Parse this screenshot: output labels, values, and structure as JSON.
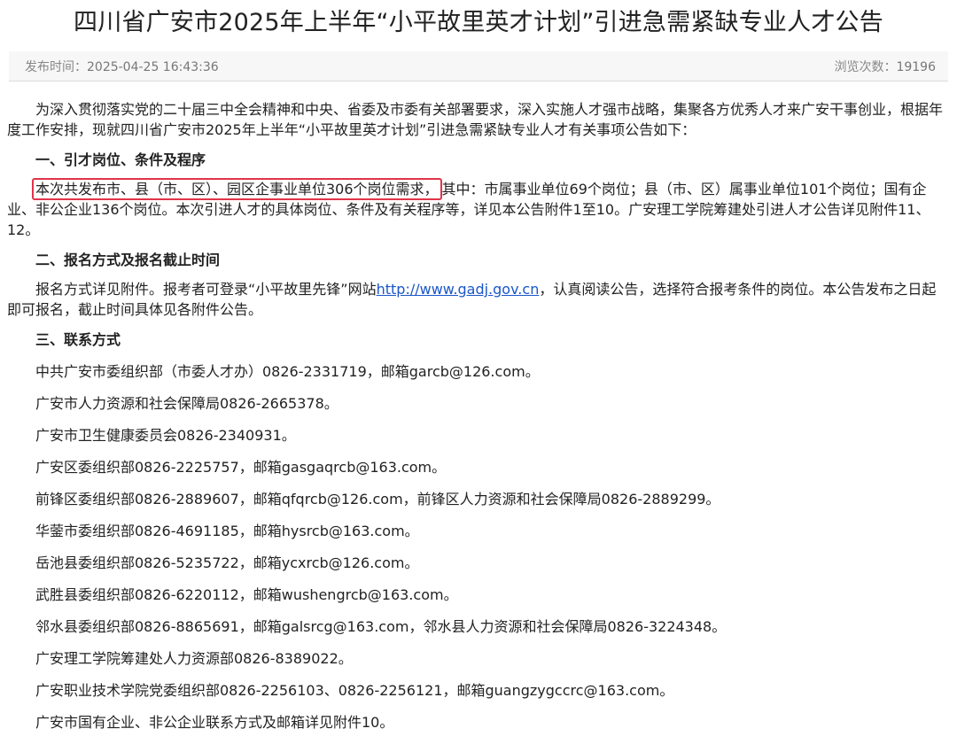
{
  "article": {
    "title": "四川省广安市2025年上半年“小平故里英才计划”引进急需紧缺专业人才公告",
    "meta": {
      "publish_label": "发布时间：",
      "publish_time": "2025-04-25 16:43:36",
      "views_label": "浏览次数：",
      "views": "19196"
    },
    "intro": "为深入贯彻落实党的二十届三中全会精神和中央、省委及市委有关部署要求，深入实施人才强市战略，集聚各方优秀人才来广安干事创业，根据年度工作安排，现就四川省广安市2025年上半年“小平故里英才计划”引进急需紧缺专业人才有关事项公告如下：",
    "section1": {
      "heading": "一、引才岗位、条件及程序",
      "highlighted": "本次共发布市、县（市、区）、园区企事业单位306个岗位需求，",
      "rest": "其中：市属事业单位69个岗位；县（市、区）属事业单位101个岗位；国有企业、非公企业136个岗位。本次引进人才的具体岗位、条件及有关程序等，详见本公告附件1至10。广安理工学院筹建处引进人才公告详见附件11、12。"
    },
    "section2": {
      "heading": "二、报名方式及报名截止时间",
      "before_link": "报名方式详见附件。报考者可登录“小平故里先锋”网站",
      "link_text": "http://www.gadj.gov.cn",
      "after_link": "，认真阅读公告，选择符合报考条件的岗位。本公告发布之日起即可报名，截止时间具体见各附件公告。"
    },
    "section3": {
      "heading": "三、联系方式",
      "contacts": [
        "中共广安市委组织部（市委人才办）0826-2331719，邮箱garcb@126.com。",
        "广安市人力资源和社会保障局0826-2665378。",
        "广安市卫生健康委员会0826-2340931。",
        "广安区委组织部0826-2225757，邮箱gasgaqrcb@163.com。",
        "前锋区委组织部0826-2889607，邮箱qfqrcb@126.com，前锋区人力资源和社会保障局0826-2889299。",
        "华蓥市委组织部0826-4691185，邮箱hysrcb@163.com。",
        "岳池县委组织部0826-5235722，邮箱ycxrcb@126.com。",
        "武胜县委组织部0826-6220112，邮箱wushengrcb@163.com。",
        "邻水县委组织部0826-8865691，邮箱galsrcg@163.com，邻水县人力资源和社会保障局0826-3224348。",
        "广安理工学院筹建处人力资源部0826-8389022。",
        "广安职业技术学院党委组织部0826-2256103、0826-2256121，邮箱guangzygccrc@163.com。",
        "广安市国有企业、非公企业联系方式及邮箱详见附件10。"
      ]
    }
  },
  "colors": {
    "highlight_border": "#e0344a",
    "link": "#1a56c8",
    "meta_text": "#888888"
  }
}
